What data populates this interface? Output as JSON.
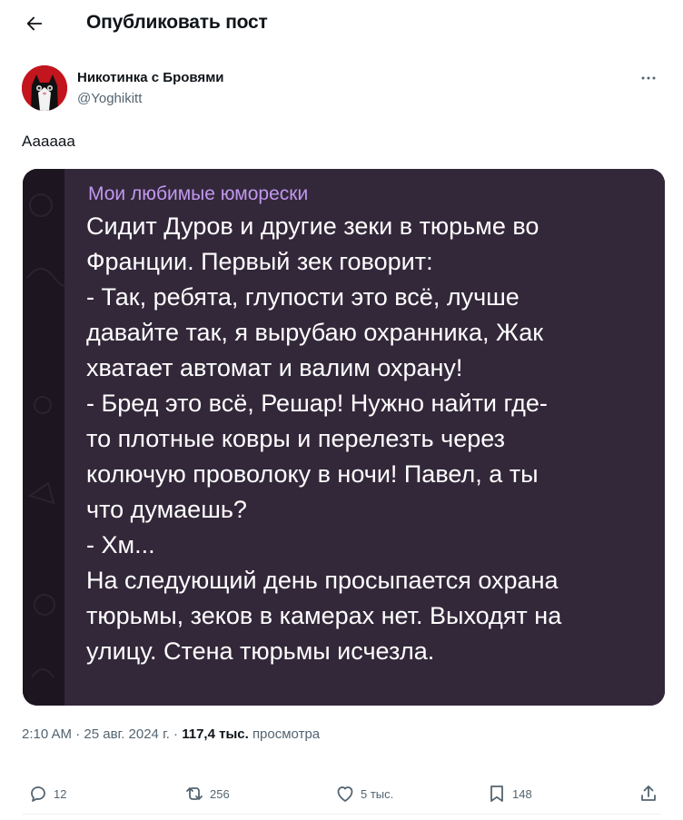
{
  "header": {
    "title": "Опубликовать пост"
  },
  "author": {
    "display_name": "Никотинка с Бровями",
    "handle": "@Yoghikitt"
  },
  "post": {
    "text": "Аааааа",
    "image": {
      "sender": "Мои любимые юморески",
      "message_lines": [
        "Сидит Дуров и другие зеки в тюрьме во",
        "Франции. Первый зек говорит:",
        "- Так, ребята, глупости это всё, лучше",
        "давайте так, я вырубаю охранника, Жак",
        "хватает автомат и валим охрану!",
        "- Бред это всё, Решар! Нужно найти где-",
        "то плотные ковры и перелезть через",
        "колючую проволоку в ночи! Павел, а ты",
        "что думаешь?",
        "- Хм...",
        "На следующий день просыпается охрана",
        "тюрьмы, зеков в камерах нет. Выходят на",
        "улицу. Стена тюрьмы исчезла."
      ]
    }
  },
  "meta": {
    "time": "2:10 AM",
    "date": "25 авг. 2024 г.",
    "separator": "·",
    "views_count": "117,4 тыс.",
    "views_label": "просмотра"
  },
  "actions": {
    "replies": "12",
    "reposts": "256",
    "likes": "5 тыс.",
    "bookmarks": "148"
  },
  "icons": [
    "back-arrow-icon",
    "more-icon",
    "reply-icon",
    "repost-icon",
    "like-icon",
    "bookmark-icon",
    "share-icon"
  ],
  "colors": {
    "text": "#0f1419",
    "secondary": "#536471",
    "bubble": "#33283a",
    "sender_name": "#c197ee"
  }
}
